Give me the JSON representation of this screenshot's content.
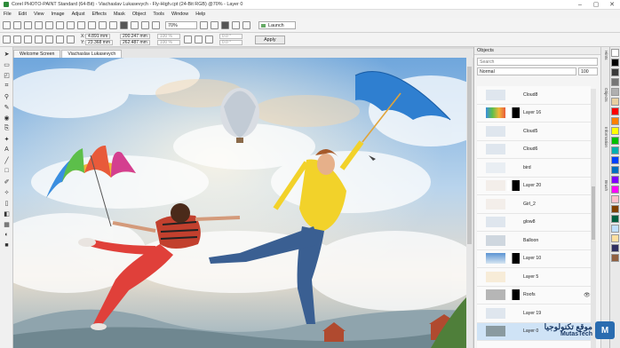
{
  "window": {
    "title": "Corel PHOTO-PAINT Standard (64-Bit) - Viachaslav Lukasevych - Fly-High.cpt (24-Bit RGB) @70% - Layer 0",
    "controls": [
      "–",
      "▢",
      "✕"
    ]
  },
  "menu": [
    "File",
    "Edit",
    "View",
    "Image",
    "Adjust",
    "Effects",
    "Mask",
    "Object",
    "Tools",
    "Window",
    "Help"
  ],
  "toolbar": {
    "zoom": "70%",
    "launch_label": "Launch"
  },
  "property_bar": {
    "x_label": "X:",
    "x_value": "4.891 mm",
    "y_label": "Y:",
    "y_value": "23.368 mm",
    "w_value": "200.247 mm",
    "h_value": "262.487 mm",
    "w_pct": "100 %",
    "h_pct": "100 %",
    "angle1": "0.0 °",
    "angle2": "0.0 °",
    "apply_label": "Apply"
  },
  "doc_tabs": [
    {
      "label": "Welcome Screen",
      "active": false
    },
    {
      "label": "Viachaslav Lukasevych",
      "active": true
    }
  ],
  "objects_panel": {
    "title": "Objects",
    "search_placeholder": "Search",
    "blend_mode": "Normal",
    "opacity": "100",
    "layers": [
      {
        "name": "Cloud8",
        "thumb": "cloud",
        "mask": false,
        "visible": false,
        "selected": false
      },
      {
        "name": "Layer 16",
        "thumb": "umbrella-rainbow",
        "mask": true,
        "visible": false,
        "selected": false
      },
      {
        "name": "Cloud5",
        "thumb": "cloud",
        "mask": false,
        "visible": false,
        "selected": false
      },
      {
        "name": "Cloud6",
        "thumb": "cloud",
        "mask": false,
        "visible": false,
        "selected": false
      },
      {
        "name": "bird",
        "thumb": "bird",
        "mask": false,
        "visible": false,
        "selected": false
      },
      {
        "name": "Layer 20",
        "thumb": "girl",
        "mask": true,
        "visible": false,
        "selected": false
      },
      {
        "name": "Girl_2",
        "thumb": "girl",
        "mask": false,
        "visible": false,
        "selected": false
      },
      {
        "name": "glow8",
        "thumb": "cloud",
        "mask": false,
        "visible": false,
        "selected": false
      },
      {
        "name": "Balloon",
        "thumb": "balloon",
        "mask": false,
        "visible": false,
        "selected": false
      },
      {
        "name": "Layer 10",
        "thumb": "sky",
        "mask": true,
        "visible": false,
        "selected": false
      },
      {
        "name": "Layer 5",
        "thumb": "light",
        "mask": false,
        "visible": false,
        "selected": false
      },
      {
        "name": "Roofs",
        "thumb": "roofs",
        "mask": true,
        "visible": true,
        "selected": false
      },
      {
        "name": "Layer 19",
        "thumb": "cloud",
        "mask": false,
        "visible": false,
        "selected": false
      },
      {
        "name": "Layer 0",
        "thumb": "city",
        "mask": false,
        "visible": false,
        "selected": true
      }
    ]
  },
  "side_tabs": [
    "Hints",
    "Objects",
    "Information",
    "Brush"
  ],
  "palette": [
    "#ffffff",
    "#000000",
    "#3a3a3a",
    "#767676",
    "#b0b0b0",
    "#e8d0a0",
    "#ff0000",
    "#ff8000",
    "#ffff00",
    "#00c000",
    "#00b0b0",
    "#0040ff",
    "#0070c0",
    "#8000ff",
    "#ff00ff",
    "#ffc0cb",
    "#804000",
    "#006040",
    "#c0e0ff",
    "#ffe0a0",
    "#303060",
    "#906040"
  ],
  "watermark": {
    "arabic": "موقع تكنولوجيا",
    "english": "MutasTech",
    "logo": "M"
  }
}
